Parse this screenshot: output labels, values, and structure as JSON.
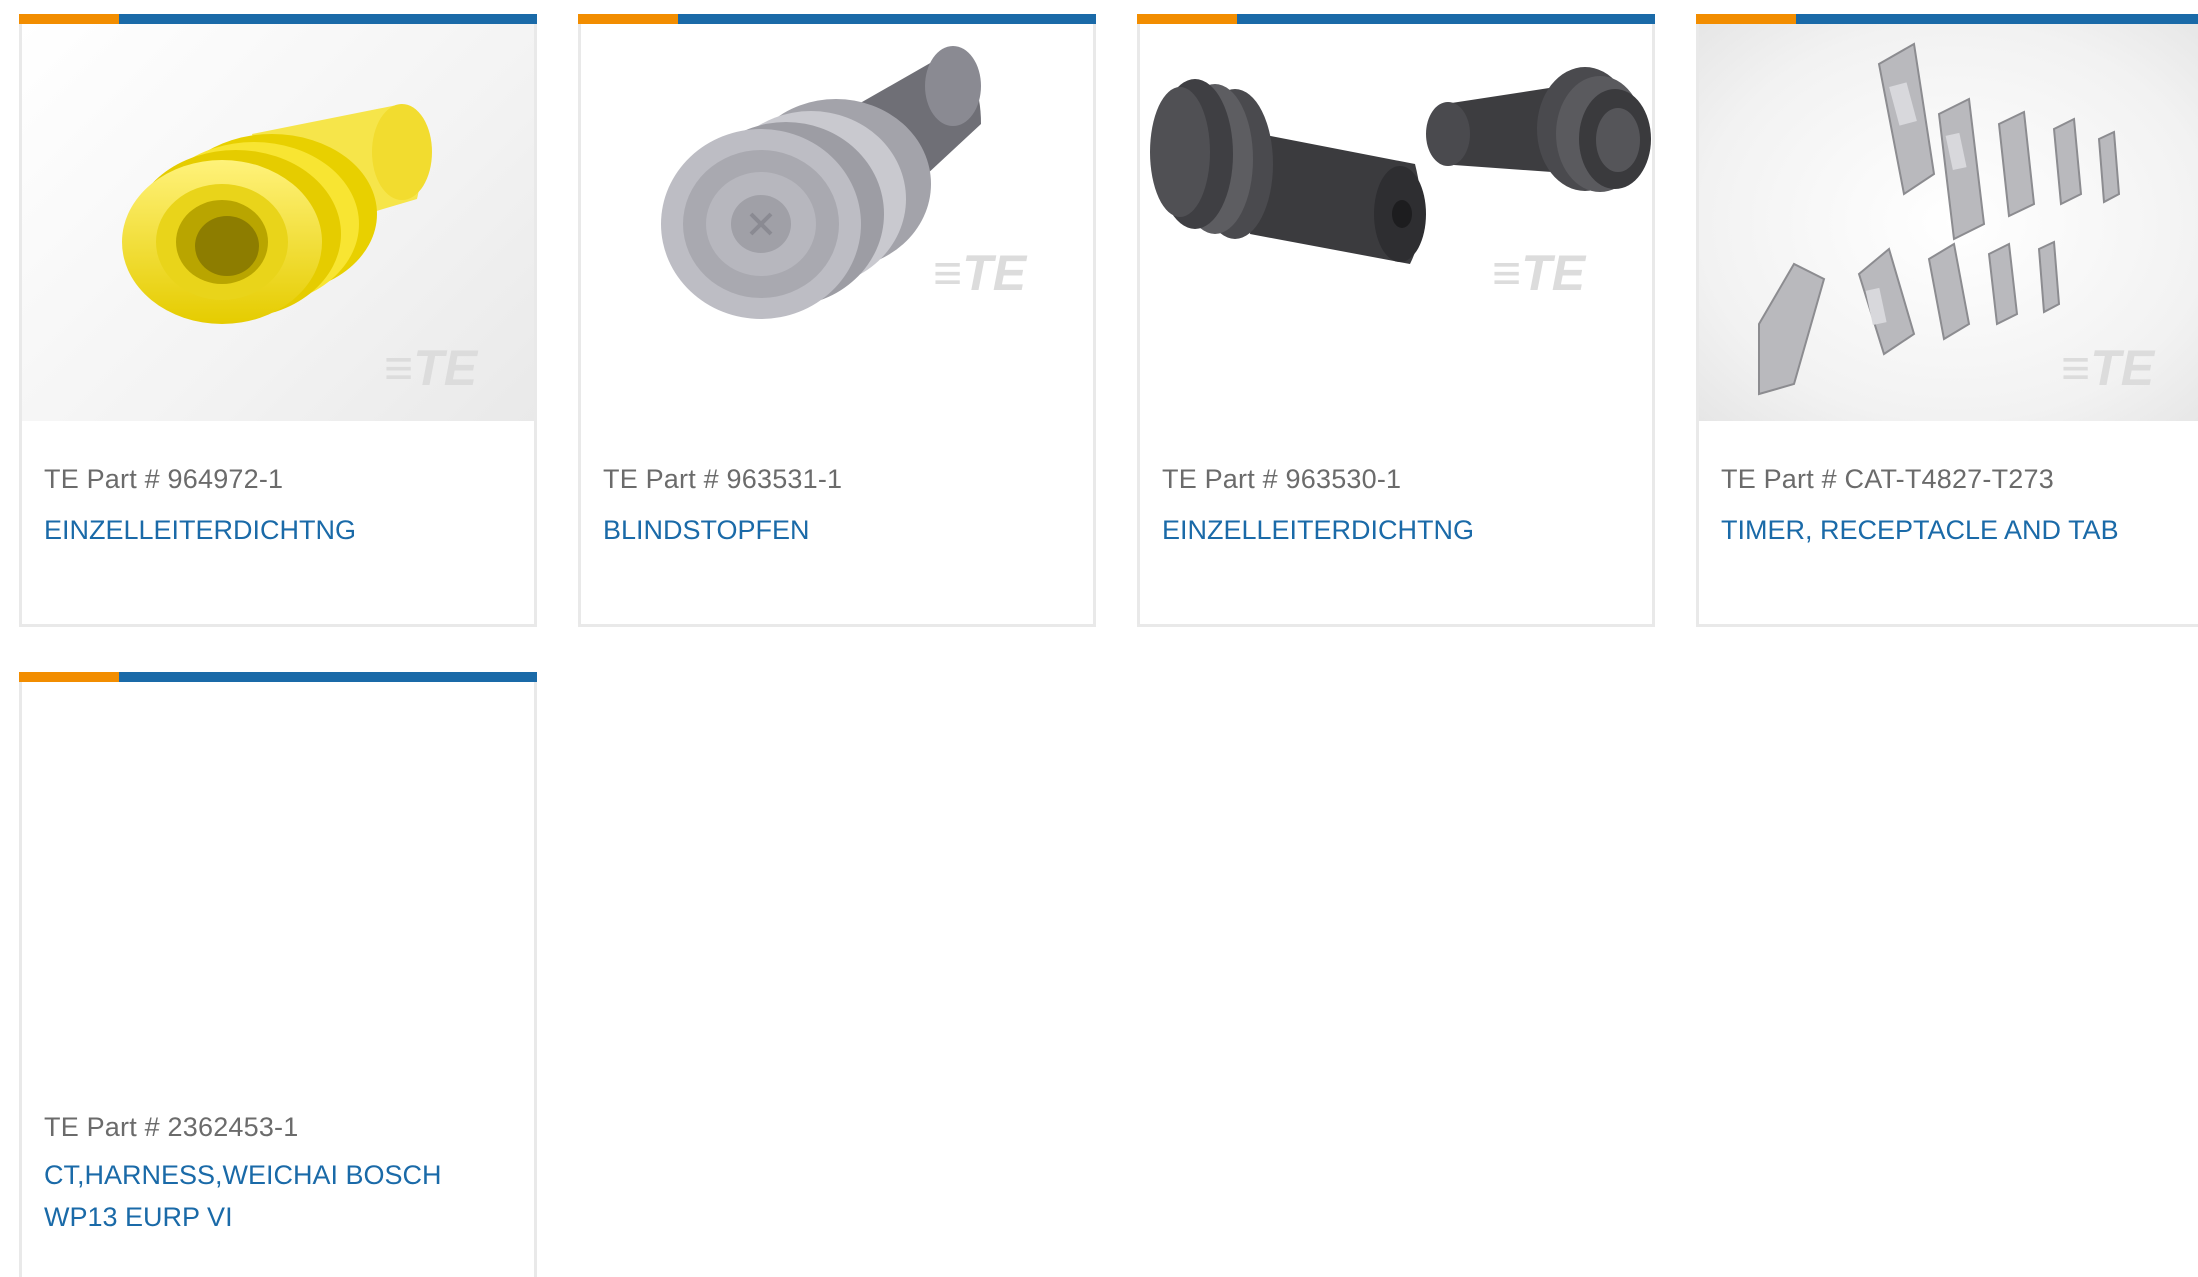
{
  "products": [
    {
      "part_label": "TE Part # 964972-1",
      "name": "EINZELLEITERDICHTNG",
      "image_icon": "yellow-wire-seal-image"
    },
    {
      "part_label": "TE Part # 963531-1",
      "name": "BLINDSTOPFEN",
      "image_icon": "gray-blind-plug-image"
    },
    {
      "part_label": "TE Part # 963530-1",
      "name": "EINZELLEITERDICHTNG",
      "image_icon": "dark-wire-seals-image"
    },
    {
      "part_label": "TE Part # CAT-T4827-T273",
      "name": "TIMER, RECEPTACLE AND TAB",
      "image_icon": "receptacle-tab-terminals-image"
    },
    {
      "part_label": "TE Part # 2362453-1",
      "name": "CT,HARNESS,WEICHAI BOSCH WP13 EURP VI",
      "image_icon": "no-image"
    }
  ],
  "watermark": "TE",
  "colors": {
    "accent_orange": "#f28d00",
    "accent_blue": "#1a6aa8",
    "link_blue": "#1a6aa8",
    "muted_text": "#6b6b6b",
    "card_border": "#e9e9e9"
  }
}
